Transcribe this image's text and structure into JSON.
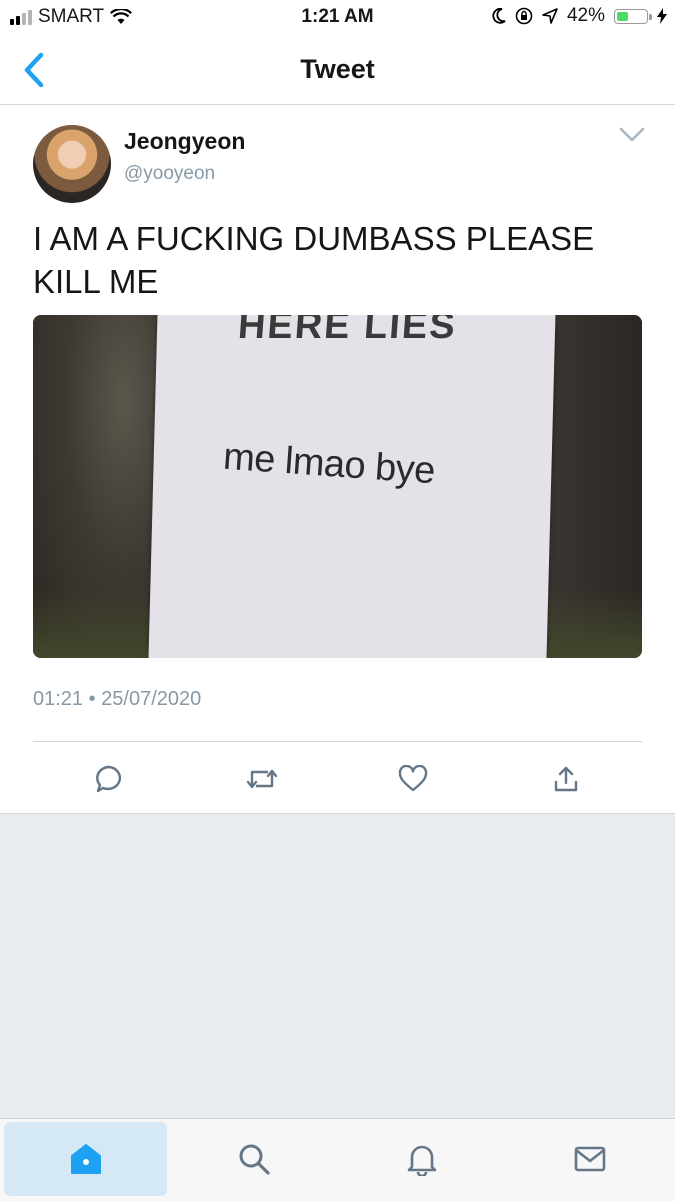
{
  "status_bar": {
    "carrier": "SMART",
    "time": "1:21 AM",
    "battery_percent": "42%",
    "battery_level": 0.42,
    "battery_color": "#4cd964"
  },
  "header": {
    "title": "Tweet",
    "back_icon": "chevron-left-icon",
    "accent_color": "#1da1f2"
  },
  "tweet": {
    "display_name": "Jeongyeon",
    "handle": "@yooyeon",
    "text": "I AM A FUCKING DUMBASS PLEASE KILL ME",
    "media": {
      "top_text": "HERE LIES",
      "caption": "me lmao bye"
    },
    "timestamp": "01:21 • 25/07/2020",
    "actions": [
      "reply-icon",
      "retweet-icon",
      "like-icon",
      "share-icon"
    ]
  },
  "tab_bar": {
    "tabs": [
      {
        "icon": "home-icon",
        "active": true
      },
      {
        "icon": "search-icon",
        "active": false
      },
      {
        "icon": "notifications-icon",
        "active": false
      },
      {
        "icon": "messages-icon",
        "active": false
      }
    ]
  }
}
